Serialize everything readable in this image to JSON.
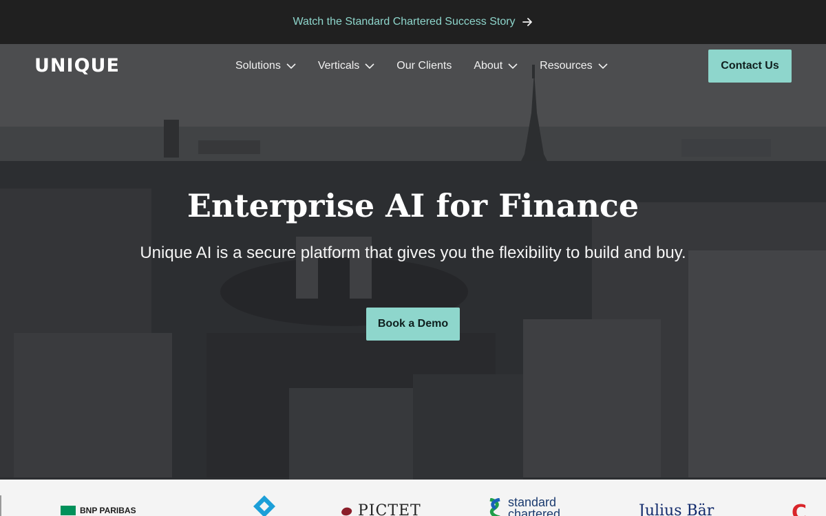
{
  "announcement": {
    "text": "Watch the Standard Chartered Success Story",
    "icon": "arrow-right-icon"
  },
  "brand": {
    "logo_text": "UNIQUE"
  },
  "nav": {
    "items": [
      {
        "label": "Solutions",
        "has_dropdown": true
      },
      {
        "label": "Verticals",
        "has_dropdown": true
      },
      {
        "label": "Our Clients",
        "has_dropdown": false
      },
      {
        "label": "About",
        "has_dropdown": true
      },
      {
        "label": "Resources",
        "has_dropdown": true
      }
    ],
    "contact_label": "Contact Us"
  },
  "hero": {
    "title": "Enterprise AI for Finance",
    "subtitle": "Unique AI is a secure platform that gives you the flexibility to build and buy.",
    "cta_label": "Book a Demo"
  },
  "clients": {
    "bnp": "BNP PARIBAS",
    "pictet": "PICTET",
    "standard_chartered": [
      "standard",
      "chartered"
    ],
    "julius_baer": "Julius Bär",
    "partial": "C"
  },
  "colors": {
    "accent": "#8ed6cc",
    "announcement_bg": "#202020",
    "logo_strip_bg": "#f4f4f4"
  }
}
